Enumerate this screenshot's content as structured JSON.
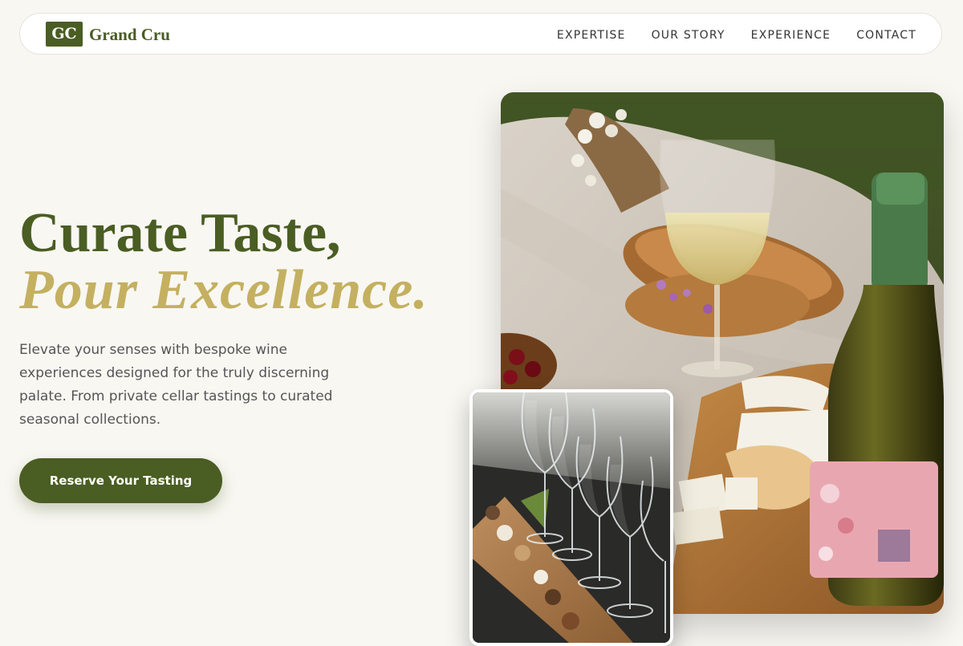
{
  "brand": {
    "badge": "GC",
    "name": "Grand Cru",
    "color": "#4a5d23"
  },
  "nav": {
    "links": [
      "EXPERTISE",
      "OUR STORY",
      "EXPERIENCE",
      "CONTACT"
    ]
  },
  "hero": {
    "title_line1": "Curate Taste,",
    "title_line2": "Pour Excellence.",
    "description": "Elevate your senses with bespoke wine experiences designed for the truly discerning palate. From private cellar tastings to curated seasonal collections.",
    "cta_label": "Reserve Your Tasting",
    "accent_color": "#c4b060"
  },
  "images": {
    "main": "picnic-wine-photo",
    "secondary": "tasting-flight-photo"
  }
}
